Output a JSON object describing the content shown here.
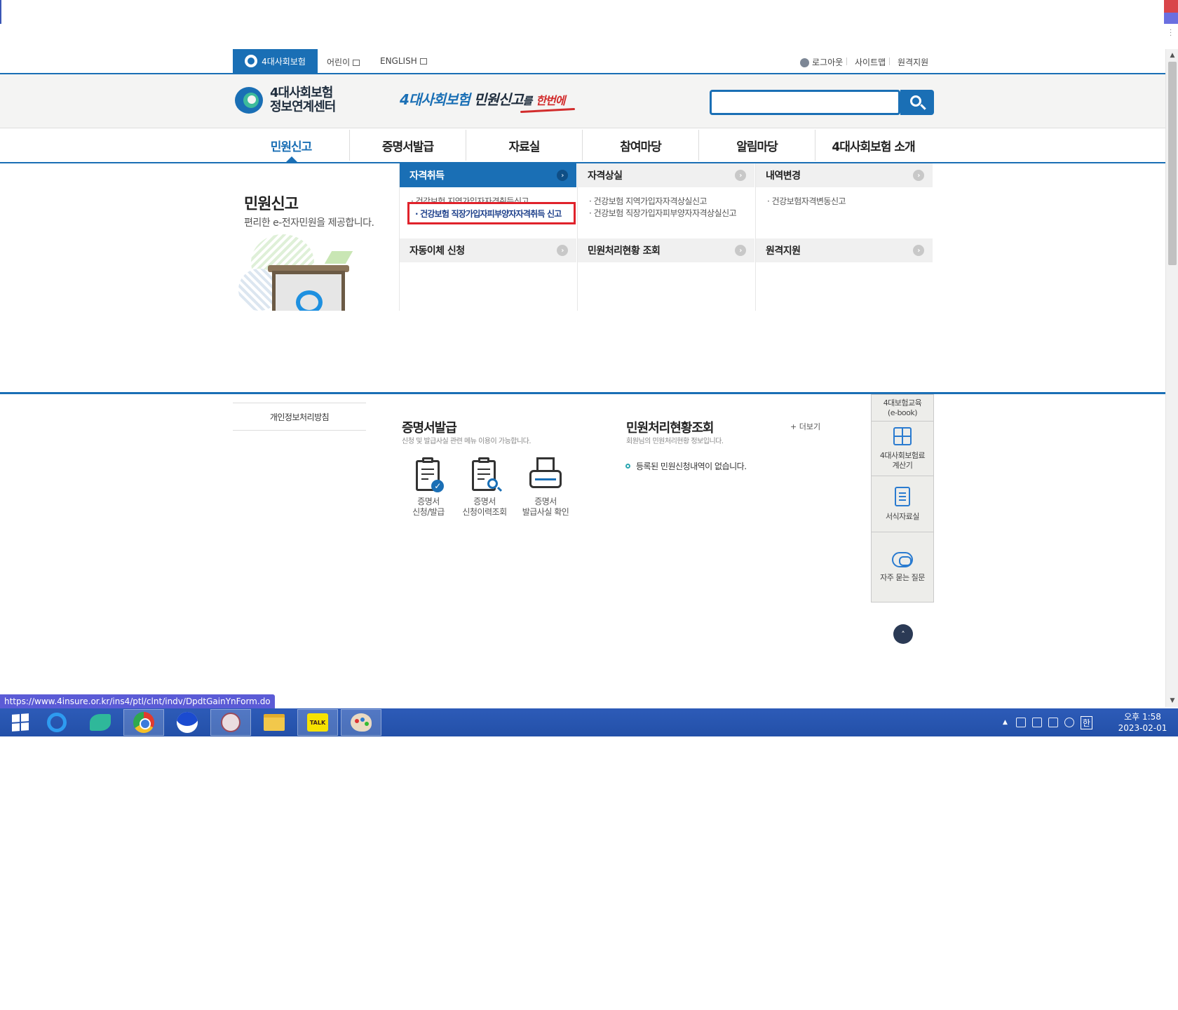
{
  "util": {
    "home_label": "4대사회보험",
    "kids_label": "어린이",
    "english_label": "ENGLISH",
    "logout_label": "로그아웃",
    "sitemap_label": "사이트맵",
    "remote_label": "원격지원"
  },
  "header": {
    "brand_line1": "4대사회보험",
    "brand_line2": "정보연계센터",
    "slogan_part1": "4대사회보험",
    "slogan_part2": "민원신고",
    "slogan_part3": "를",
    "slogan_part4": "한번에",
    "search_value": ""
  },
  "gnb": {
    "items": [
      {
        "label": "민원신고"
      },
      {
        "label": "증명서발급"
      },
      {
        "label": "자료실"
      },
      {
        "label": "참여마당"
      },
      {
        "label": "알림마당"
      },
      {
        "label": "4대사회보험 소개"
      }
    ]
  },
  "mega": {
    "title": "민원신고",
    "subtitle": "편리한 e-전자민원을 제공합니다.",
    "columns": [
      {
        "head": "자격취득",
        "links": [
          "· 건강보험 지역가입자자격취득신고",
          "· 건강보험 직장가입자피부양자자격취득 신고"
        ],
        "sub_head": "자동이체 신청"
      },
      {
        "head": "자격상실",
        "links": [
          "· 건강보험 지역가입자자격상실신고",
          "· 건강보험 직장가입자피부양자자격상실신고"
        ],
        "sub_head": "민원처리현황 조회"
      },
      {
        "head": "내역변경",
        "links": [
          "· 건강보험자격변동신고"
        ],
        "sub_head": "원격지원"
      }
    ],
    "arrow_glyph": "›"
  },
  "footer": {
    "privacy_label": "개인정보처리방침",
    "cert": {
      "title": "증명서발급",
      "subtitle": "신청 및 발급사실 관련 메뉴 이용이 가능합니다.",
      "items": [
        {
          "line1": "증명서",
          "line2": "신청/발급",
          "icon": "clipboard-check-icon"
        },
        {
          "line1": "증명서",
          "line2": "신청이력조회",
          "icon": "clipboard-search-icon"
        },
        {
          "line1": "증명서",
          "line2": "발급사실 확인",
          "icon": "printer-icon"
        }
      ]
    },
    "status": {
      "title": "민원처리현황조회",
      "subtitle": "회원님의 민원처리현황 정보입니다.",
      "more_label": "+ 더보기",
      "empty_label": "등록된 민원신청내역이 없습니다."
    },
    "quick": [
      {
        "line1": "4대보험교육",
        "line2": "(e-book)"
      },
      {
        "line1": "4대사회보험료",
        "line2": "계산기"
      },
      {
        "line1": "서식자료실",
        "line2": ""
      },
      {
        "line1": "자주 묻는 질문",
        "line2": ""
      }
    ],
    "top_glyph": "˄"
  },
  "status_url": "https://www.4insure.or.kr/ins4/ptl/clnt/indv/DpdtGainYnForm.do",
  "taskbar": {
    "apps": [
      "windows-start",
      "internet-explorer",
      "bird-app",
      "chrome",
      "moon-app",
      "snipping-tool",
      "file-explorer",
      "kakaotalk",
      "paint"
    ],
    "talk_label": "TALK",
    "ime_label": "한",
    "tray_chevron": "▲",
    "clock_time": "오후 1:58",
    "clock_date": "2023-02-01"
  },
  "colors": {
    "primary": "#1a6fb5",
    "highlight_border": "#e0222b",
    "taskbar": "#2350a8"
  }
}
